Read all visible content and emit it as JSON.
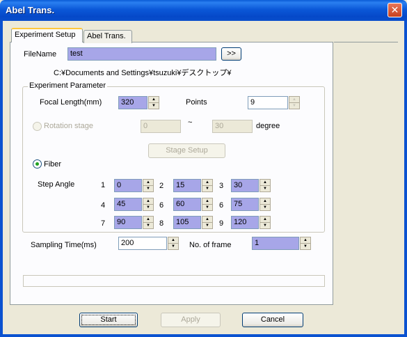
{
  "window": {
    "title": "Abel Trans.",
    "close_glyph": "✕"
  },
  "tabs": [
    {
      "label": "Experiment Setup"
    },
    {
      "label": "Abel Trans."
    }
  ],
  "file": {
    "label": "FileName",
    "value": "test",
    "browse_label": ">>",
    "path": "C:¥Documents and Settings¥tsuzuki¥デスクトップ¥"
  },
  "group": {
    "title": "Experiment Parameter"
  },
  "focal": {
    "label": "Focal Length(mm)",
    "value": "320"
  },
  "points": {
    "label": "Points",
    "value": "9"
  },
  "rotation": {
    "label": "Rotation stage",
    "from": "0",
    "tilde": "~",
    "to": "30",
    "unit": "degree"
  },
  "stage_setup": {
    "label": "Stage Setup"
  },
  "fiber": {
    "label": "Fiber"
  },
  "step": {
    "label": "Step Angle",
    "items": [
      {
        "n": "1",
        "v": "0"
      },
      {
        "n": "2",
        "v": "15"
      },
      {
        "n": "3",
        "v": "30"
      },
      {
        "n": "4",
        "v": "45"
      },
      {
        "n": "6",
        "v": "60"
      },
      {
        "n": "6",
        "v": "75"
      },
      {
        "n": "7",
        "v": "90"
      },
      {
        "n": "8",
        "v": "105"
      },
      {
        "n": "9",
        "v": "120"
      }
    ]
  },
  "sampling": {
    "label": "Sampling Time(ms)",
    "value": "200"
  },
  "frames": {
    "label": "No. of frame",
    "value": "1"
  },
  "buttons": {
    "start": "Start",
    "apply": "Apply",
    "cancel": "Cancel"
  },
  "spin": {
    "up": "▲",
    "down": "▼"
  }
}
